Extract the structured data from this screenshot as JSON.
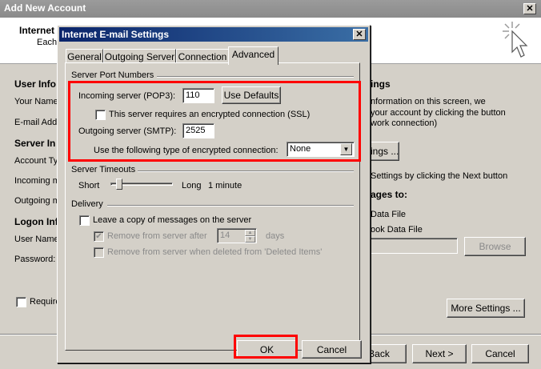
{
  "outer": {
    "title": "Add New Account",
    "header_line1": "Internet",
    "header_line2": "Each",
    "user_info": "User Info",
    "your_name": "Your Name",
    "email_address": "E-mail Addr",
    "server_info": "Server In",
    "account_type": "Account Ty",
    "incoming": "Incoming m",
    "outgoing": "Outgoing m",
    "logon_info": "Logon Info",
    "user_name": "User Name",
    "password": "Password:",
    "require": "Require",
    "right_heading": "ings",
    "right_text1": "nformation on this screen, we",
    "right_text2": "your account by clicking the button",
    "right_text3": "work connection)",
    "test_button": "ings ...",
    "right_text4": "Settings by clicking the Next button",
    "deliver_heading": "ages to:",
    "option_new": "Data File",
    "option_existing": "ook Data File",
    "browse_button": "Browse",
    "more_settings_button": "More Settings ...",
    "back_button": "Back",
    "next_button": "Next >",
    "cancel_button": "Cancel"
  },
  "dialog": {
    "title": "Internet E-mail Settings",
    "tabs": [
      "General",
      "Outgoing Server",
      "Connection",
      "Advanced"
    ],
    "active_tab": "Advanced",
    "ports_group": "Server Port Numbers",
    "incoming_label": "Incoming server (POP3):",
    "incoming_value": "110",
    "use_defaults_button": "Use Defaults",
    "ssl_label": "This server requires an encrypted connection (SSL)",
    "outgoing_label": "Outgoing server (SMTP):",
    "outgoing_value": "2525",
    "encryption_label": "Use the following type of encrypted connection:",
    "encryption_value": "None",
    "timeouts_group": "Server Timeouts",
    "short_label": "Short",
    "long_label": "Long",
    "timeout_value": "1 minute",
    "timeout_level": 0.1,
    "delivery_group": "Delivery",
    "leave_copy_label": "Leave a copy of messages on the server",
    "remove_after_label": "Remove from server after",
    "remove_days_value": "14",
    "days_label": "days",
    "remove_deleted_label": "Remove from server when deleted from 'Deleted Items'",
    "ok_button": "OK",
    "cancel_button": "Cancel"
  },
  "colors": {
    "highlight_box": "#ff0000",
    "dialog_title_bar": "#0a246a",
    "window_background": "#d4d0c8"
  }
}
